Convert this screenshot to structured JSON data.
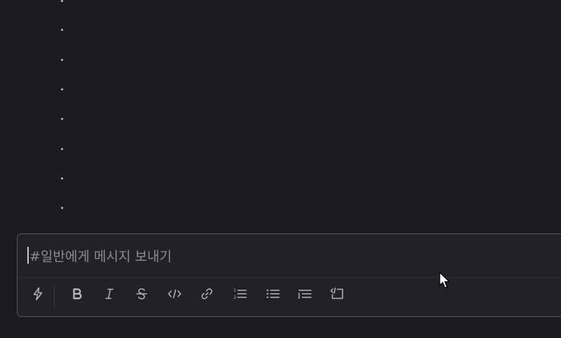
{
  "composer": {
    "placeholder": "#일반에게 메시지 보내기"
  },
  "toolbar": {
    "buttons": [
      {
        "name": "shortcuts-button",
        "icon": "lightning-icon"
      },
      {
        "name": "bold-button",
        "icon": "bold-icon"
      },
      {
        "name": "italic-button",
        "icon": "italic-icon"
      },
      {
        "name": "strikethrough-button",
        "icon": "strikethrough-icon"
      },
      {
        "name": "code-button",
        "icon": "code-icon"
      },
      {
        "name": "link-button",
        "icon": "link-icon"
      },
      {
        "name": "ordered-list-button",
        "icon": "ordered-list-icon"
      },
      {
        "name": "bullet-list-button",
        "icon": "bullet-list-icon"
      },
      {
        "name": "blockquote-button",
        "icon": "blockquote-icon"
      },
      {
        "name": "code-block-button",
        "icon": "code-block-icon"
      }
    ]
  },
  "colors": {
    "background": "#1c1b22",
    "composer_bg": "#222226",
    "composer_border": "#56565c",
    "icon": "#b5b5ba",
    "placeholder": "#8a8a90"
  }
}
